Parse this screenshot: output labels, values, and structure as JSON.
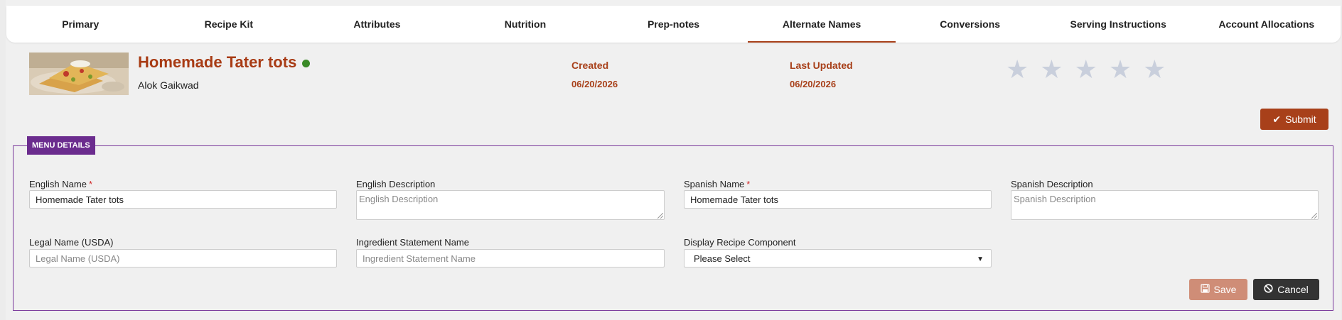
{
  "tabs": [
    {
      "label": "Primary",
      "active": false
    },
    {
      "label": "Recipe Kit",
      "active": false
    },
    {
      "label": "Attributes",
      "active": false
    },
    {
      "label": "Nutrition",
      "active": false
    },
    {
      "label": "Prep-notes",
      "active": false
    },
    {
      "label": "Alternate Names",
      "active": true
    },
    {
      "label": "Conversions",
      "active": false
    },
    {
      "label": "Serving Instructions",
      "active": false
    },
    {
      "label": "Account Allocations",
      "active": false
    }
  ],
  "recipe": {
    "title": "Homemade Tater tots",
    "status_color": "#3a8a27",
    "author": "Alok Gaikwad",
    "created_label": "Created",
    "created_value": "06/20/2026",
    "updated_label": "Last Updated",
    "updated_value": "06/20/2026",
    "rating": 0,
    "rating_max": 5
  },
  "actions": {
    "submit_label": "Submit",
    "save_label": "Save",
    "cancel_label": "Cancel"
  },
  "menu_details": {
    "legend": "MENU DETAILS",
    "english_name_label": "English Name",
    "english_name_value": "Homemade Tater tots",
    "english_desc_label": "English Description",
    "english_desc_placeholder": "English Description",
    "spanish_name_label": "Spanish Name",
    "spanish_name_value": "Homemade Tater tots",
    "spanish_desc_label": "Spanish Description",
    "spanish_desc_placeholder": "Spanish Description",
    "legal_name_label": "Legal Name (USDA)",
    "legal_name_placeholder": "Legal Name (USDA)",
    "ingredient_stmt_label": "Ingredient Statement Name",
    "ingredient_stmt_placeholder": "Ingredient Statement Name",
    "display_component_label": "Display Recipe Component",
    "display_component_value": "Please Select",
    "required_mark": "*"
  },
  "colors": {
    "accent": "#a8401a",
    "fieldset_border": "#7b3a9c",
    "legend_bg": "#6b2c8e"
  }
}
